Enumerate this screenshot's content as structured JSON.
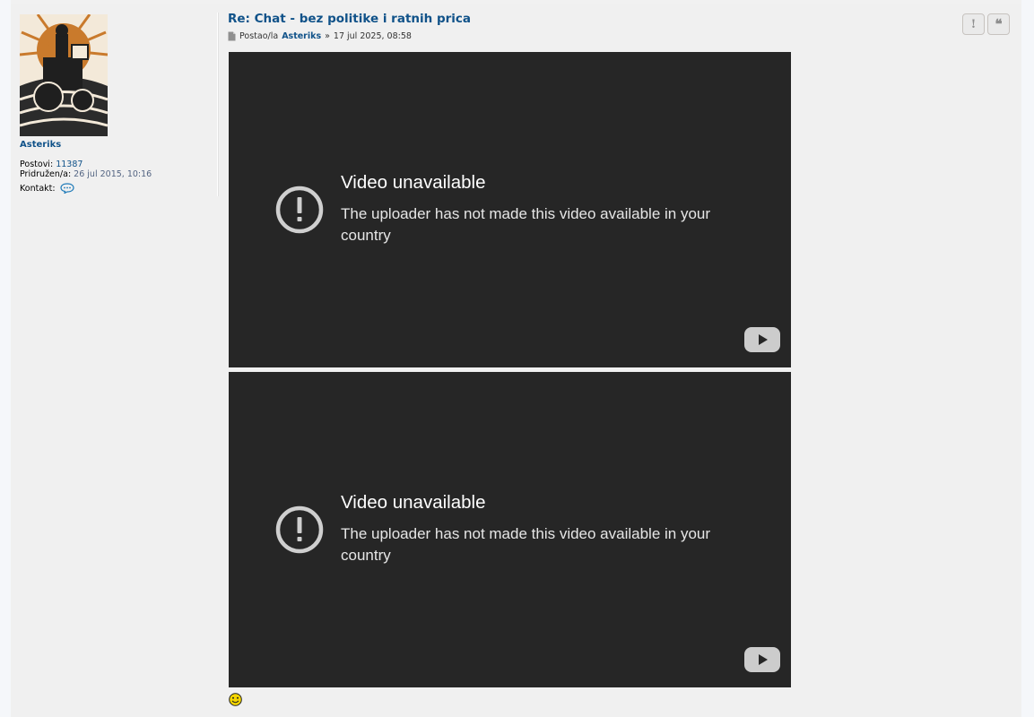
{
  "post": {
    "title": "Re: Chat - bez politike i ratnih prica",
    "meta": {
      "prefix": "Postao/la",
      "author": "Asteriks",
      "separator": "»",
      "date": "17 jul 2025, 08:58"
    },
    "buttons": {
      "report": "!",
      "quote": "❝"
    }
  },
  "profile": {
    "username": "Asteriks",
    "posts_label": "Postovi:",
    "posts_value": "11387",
    "joined_label": "Pridružen/a:",
    "joined_value": "26 jul 2015, 10:16",
    "contact_label": "Kontakt:"
  },
  "videos": [
    {
      "title": "Video unavailable",
      "message": "The uploader has not made this video available in your country"
    },
    {
      "title": "Video unavailable",
      "message": "The uploader has not made this video available in your country"
    }
  ],
  "colors": {
    "link": "#105289",
    "post_bg": "#f0f0f0",
    "video_bg": "#262626",
    "avatar_orange": "#c97a2c"
  },
  "icons": {
    "post": "document-icon",
    "contact": "speech-bubble-icon",
    "video_alert": "alert-circle-icon",
    "video_logo": "youtube-icon",
    "smiley": "smiley-icon"
  }
}
